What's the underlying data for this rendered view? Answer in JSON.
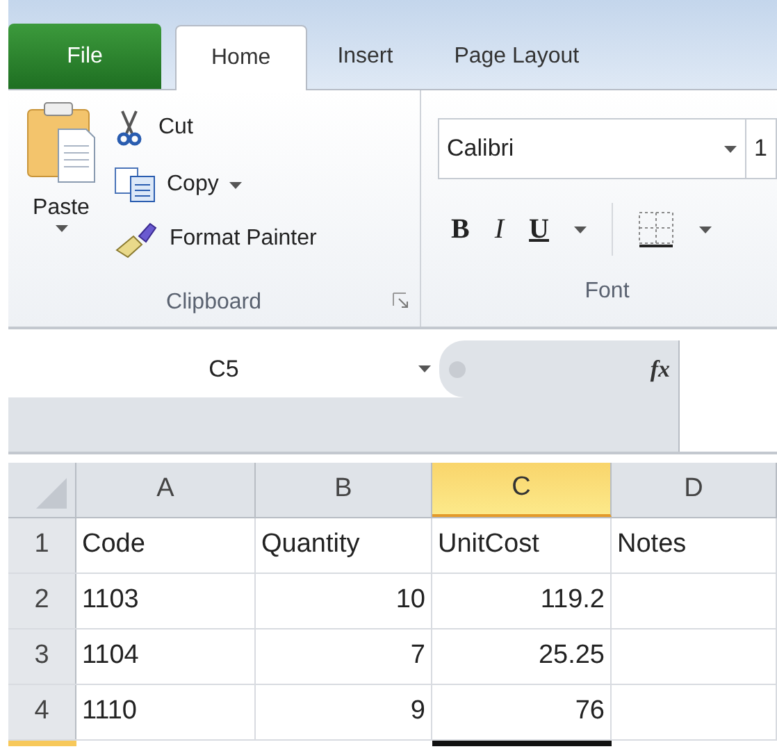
{
  "tabs": [
    {
      "label": "File",
      "kind": "file",
      "selected": false
    },
    {
      "label": "Home",
      "kind": "tab",
      "selected": true
    },
    {
      "label": "Insert",
      "kind": "tab",
      "selected": false
    },
    {
      "label": "Page Layout",
      "kind": "tab",
      "selected": false
    }
  ],
  "clipboard": {
    "paste": "Paste",
    "cut": "Cut",
    "copy": "Copy",
    "format_painter": "Format Painter",
    "label": "Clipboard"
  },
  "font": {
    "name": "Calibri",
    "size": "1",
    "bold": "B",
    "italic": "I",
    "underline": "U",
    "label": "Font"
  },
  "name_box": "C5",
  "formula_symbol": "fx",
  "columns": [
    {
      "label": "A",
      "selected": false
    },
    {
      "label": "B",
      "selected": false
    },
    {
      "label": "C",
      "selected": true
    },
    {
      "label": "D",
      "selected": false
    }
  ],
  "rows": [
    {
      "number": "1",
      "cells": [
        {
          "text": "Code",
          "kind": "text"
        },
        {
          "text": "Quantity",
          "kind": "text"
        },
        {
          "text": "UnitCost",
          "kind": "text"
        },
        {
          "text": "Notes",
          "kind": "text"
        }
      ]
    },
    {
      "number": "2",
      "cells": [
        {
          "text": "1103",
          "kind": "text"
        },
        {
          "text": "10",
          "kind": "number"
        },
        {
          "text": "119.2",
          "kind": "number"
        },
        {
          "text": "",
          "kind": "text"
        }
      ]
    },
    {
      "number": "3",
      "cells": [
        {
          "text": "1104",
          "kind": "text"
        },
        {
          "text": "7",
          "kind": "number"
        },
        {
          "text": "25.25",
          "kind": "number"
        },
        {
          "text": "",
          "kind": "text"
        }
      ]
    },
    {
      "number": "4",
      "cells": [
        {
          "text": "1110",
          "kind": "text"
        },
        {
          "text": "9",
          "kind": "number"
        },
        {
          "text": "76",
          "kind": "number"
        },
        {
          "text": "",
          "kind": "text"
        }
      ]
    }
  ]
}
